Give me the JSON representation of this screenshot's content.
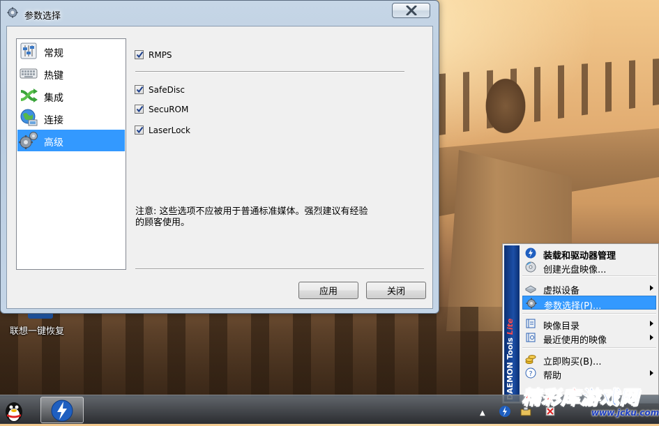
{
  "desktop": {
    "shortcut_label": "联想一键恢复"
  },
  "dialog": {
    "title": "参数选择",
    "nav_items": [
      {
        "label": "常规",
        "icon": "sliders-icon"
      },
      {
        "label": "热键",
        "icon": "keyboard-icon"
      },
      {
        "label": "集成",
        "icon": "shuffle-arrows-icon"
      },
      {
        "label": "连接",
        "icon": "globe-network-icon"
      },
      {
        "label": "高级",
        "icon": "gears-icon",
        "selected": true
      }
    ],
    "options": {
      "rmps": {
        "label": "RMPS",
        "checked": true
      },
      "safedisc": {
        "label": "SafeDisc",
        "checked": true
      },
      "securom": {
        "label": "SecuROM",
        "checked": true
      },
      "laserlock": {
        "label": "LaserLock",
        "checked": true
      }
    },
    "note_line1": "注意: 这些选项不应被用于普通标准媒体。强烈建议有经验",
    "note_line2": "的顾客使用。",
    "apply_label": "应用",
    "close_label": "关闭"
  },
  "context_menu": {
    "brand": "DAEMON Tools",
    "brand_lite": "Lite",
    "items": [
      {
        "label": "装载和驱动器管理",
        "icon": "daemon-bolt-icon",
        "bold": true,
        "submenu": false
      },
      {
        "label": "创建光盘映像...",
        "icon": "disc-create-icon",
        "submenu": false
      },
      {
        "label": "虚拟设备",
        "icon": "virtual-drive-icon",
        "submenu": true
      },
      {
        "label": "参数选择(P)...",
        "icon": "gear-icon",
        "submenu": false,
        "highlighted": true
      },
      {
        "label": "映像目录",
        "icon": "catalog-icon",
        "submenu": true
      },
      {
        "label": "最近使用的映像",
        "icon": "recent-images-icon",
        "submenu": true
      },
      {
        "label": "立即购买(B)...",
        "icon": "coins-icon",
        "submenu": false
      },
      {
        "label": "帮助",
        "icon": "help-icon",
        "submenu": true
      }
    ]
  },
  "watermark": {
    "part1": "精彩库",
    "part2": "游戏网",
    "url": "www.jcku.com"
  },
  "colors": {
    "selection": "#3399ff",
    "dialog_frame": "#b9cce0",
    "daemon_blue": "#1c4fa6",
    "watermark_red": "#ff2a2a",
    "watermark_blue": "#1e63e6"
  }
}
